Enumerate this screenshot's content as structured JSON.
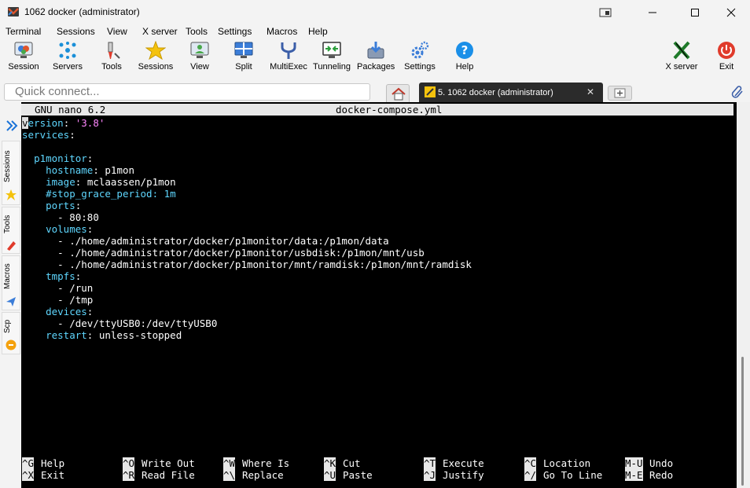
{
  "window": {
    "title": "1062 docker (administrator)"
  },
  "menubar": {
    "items": [
      "Terminal",
      "Sessions",
      "View",
      "X server",
      "Tools",
      "Settings",
      "Macros",
      "Help"
    ]
  },
  "toolbar": {
    "session": "Session",
    "servers": "Servers",
    "tools": "Tools",
    "sessions": "Sessions",
    "view": "View",
    "split": "Split",
    "multiexec": "MultiExec",
    "tunneling": "Tunneling",
    "packages": "Packages",
    "settings": "Settings",
    "help": "Help",
    "xserver": "X server",
    "exit": "Exit"
  },
  "quick_connect": {
    "placeholder": "Quick connect..."
  },
  "tabs": {
    "active_label": "5. 1062 docker (administrator)",
    "close": "✕"
  },
  "sidebar": {
    "sessions": "Sessions",
    "tools": "Tools",
    "macros": "Macros",
    "scp": "Scp"
  },
  "nano": {
    "version": "GNU nano 6.2",
    "filename": "docker-compose.yml",
    "lines": [
      {
        "key": "version",
        "sep": ": ",
        "val": "'3.8'",
        "vtype": "s",
        "indent": ""
      },
      {
        "key": "services",
        "sep": ":",
        "val": "",
        "vtype": "v",
        "indent": ""
      },
      {
        "key": "",
        "sep": "",
        "val": "",
        "vtype": "v",
        "indent": ""
      },
      {
        "key": "p1monitor",
        "sep": ":",
        "val": "",
        "vtype": "v",
        "indent": "  "
      },
      {
        "key": "hostname",
        "sep": ": ",
        "val": "p1mon",
        "vtype": "v",
        "indent": "    "
      },
      {
        "key": "image",
        "sep": ": ",
        "val": "mclaassen/p1mon",
        "vtype": "v",
        "indent": "    "
      },
      {
        "key": "#stop_grace_period: 1m",
        "sep": "",
        "val": "",
        "vtype": "c",
        "indent": "    "
      },
      {
        "key": "ports",
        "sep": ":",
        "val": "",
        "vtype": "v",
        "indent": "    "
      },
      {
        "key": "",
        "sep": "- ",
        "val": "80:80",
        "vtype": "v",
        "indent": "      "
      },
      {
        "key": "volumes",
        "sep": ":",
        "val": "",
        "vtype": "v",
        "indent": "    "
      },
      {
        "key": "",
        "sep": "- ",
        "val": "./home/administrator/docker/p1monitor/data:/p1mon/data",
        "vtype": "v",
        "indent": "      "
      },
      {
        "key": "",
        "sep": "- ",
        "val": "./home/administrator/docker/p1monitor/usbdisk:/p1mon/mnt/usb",
        "vtype": "v",
        "indent": "      "
      },
      {
        "key": "",
        "sep": "- ",
        "val": "./home/administrator/docker/p1monitor/mnt/ramdisk:/p1mon/mnt/ramdisk",
        "vtype": "v",
        "indent": "      "
      },
      {
        "key": "tmpfs",
        "sep": ":",
        "val": "",
        "vtype": "v",
        "indent": "    "
      },
      {
        "key": "",
        "sep": "- ",
        "val": "/run",
        "vtype": "v",
        "indent": "      "
      },
      {
        "key": "",
        "sep": "- ",
        "val": "/tmp",
        "vtype": "v",
        "indent": "      "
      },
      {
        "key": "devices",
        "sep": ":",
        "val": "",
        "vtype": "v",
        "indent": "    "
      },
      {
        "key": "",
        "sep": "- ",
        "val": "/dev/ttyUSB0:/dev/ttyUSB0",
        "vtype": "v",
        "indent": "      "
      },
      {
        "key": "restart",
        "sep": ": ",
        "val": "unless-stopped",
        "vtype": "v",
        "indent": "    "
      }
    ],
    "shortcuts_row1": [
      {
        "key": "^G",
        "label": "Help"
      },
      {
        "key": "^O",
        "label": "Write Out"
      },
      {
        "key": "^W",
        "label": "Where Is"
      },
      {
        "key": "^K",
        "label": "Cut"
      },
      {
        "key": "^T",
        "label": "Execute"
      },
      {
        "key": "^C",
        "label": "Location"
      },
      {
        "key": "M-U",
        "label": "Undo"
      }
    ],
    "shortcuts_row2": [
      {
        "key": "^X",
        "label": "Exit"
      },
      {
        "key": "^R",
        "label": "Read File"
      },
      {
        "key": "^\\",
        "label": "Replace"
      },
      {
        "key": "^U",
        "label": "Paste"
      },
      {
        "key": "^J",
        "label": "Justify"
      },
      {
        "key": "^/",
        "label": "Go To Line"
      },
      {
        "key": "M-E",
        "label": "Redo"
      }
    ]
  }
}
